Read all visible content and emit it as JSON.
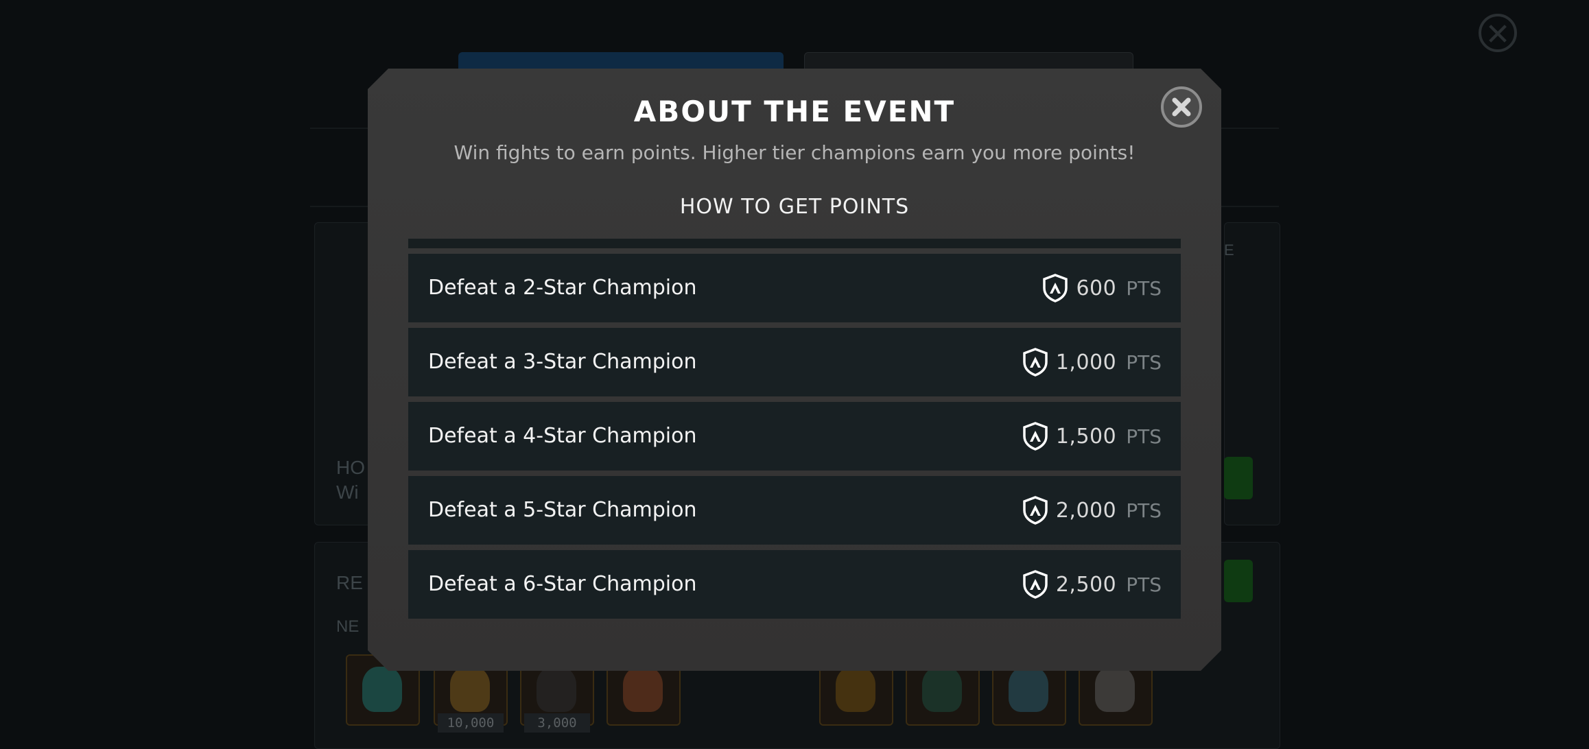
{
  "modal": {
    "title": "ABOUT THE EVENT",
    "subtitle": "Win fights to earn points. Higher tier champions earn you more points!",
    "section_title": "HOW TO GET POINTS",
    "rows": [
      {
        "label": "Defeat a 2-Star Champion",
        "points": "600",
        "unit": "PTS"
      },
      {
        "label": "Defeat a 3-Star Champion",
        "points": "1,000",
        "unit": "PTS"
      },
      {
        "label": "Defeat a 4-Star Champion",
        "points": "1,500",
        "unit": "PTS"
      },
      {
        "label": "Defeat a 5-Star Champion",
        "points": "2,000",
        "unit": "PTS"
      },
      {
        "label": "Defeat a 6-Star Champion",
        "points": "2,500",
        "unit": "PTS"
      }
    ]
  },
  "background": {
    "fragments": [
      "HO",
      "Wi",
      "RE",
      "NE",
      "E"
    ],
    "reward_counts": [
      "10,000",
      "3,000"
    ],
    "slot_badge": "x"
  },
  "colors": {
    "modal_bg": "#393939",
    "row_bg": "#182023",
    "accent_green": "#0f3b12"
  }
}
